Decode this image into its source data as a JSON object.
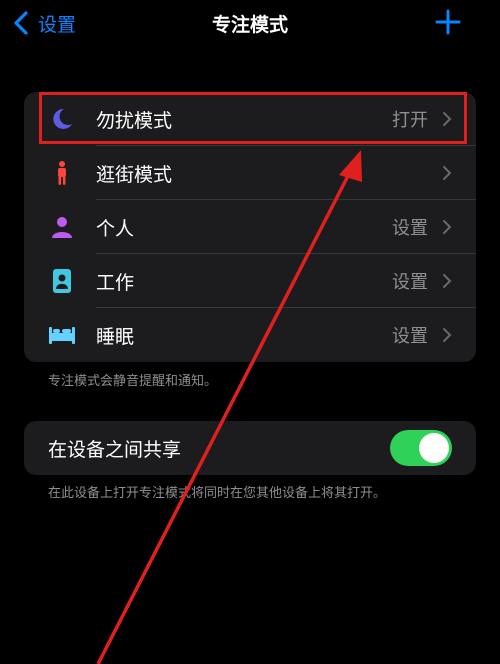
{
  "nav": {
    "back_label": "设置",
    "title": "专注模式"
  },
  "focus_modes": [
    {
      "label": "勿扰模式",
      "value": "打开",
      "icon": "moon-icon",
      "color": "#5e5ce6"
    },
    {
      "label": "逛街模式",
      "value": "",
      "icon": "person-standing-icon",
      "color": "#ff453a"
    },
    {
      "label": "个人",
      "value": "设置",
      "icon": "person-icon",
      "color": "#bf5af2"
    },
    {
      "label": "工作",
      "value": "设置",
      "icon": "id-badge-icon",
      "color": "#40c8e0"
    },
    {
      "label": "睡眠",
      "value": "设置",
      "icon": "bed-icon",
      "color": "#64d2ff"
    }
  ],
  "focus_note": "专注模式会静音提醒和通知。",
  "share": {
    "label": "在设备之间共享",
    "enabled": true
  },
  "share_note": "在此设备上打开专注模式将同时在您其他设备上将其打开。",
  "colors": {
    "accent": "#0a84ff",
    "toggle_on": "#30d158",
    "highlight": "#e0201e"
  }
}
